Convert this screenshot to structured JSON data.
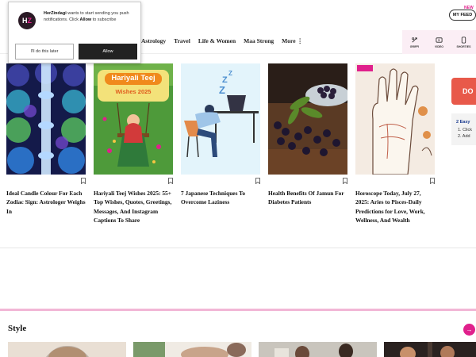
{
  "header": {
    "myfeed_badge": "NEW",
    "myfeed_label": "MY FEED"
  },
  "nav": {
    "items": [
      "Astrology",
      "Travel",
      "Life & Women",
      "Maa Strong",
      "More ⋮"
    ],
    "icons": [
      {
        "name": "griff-icon",
        "label": "GRIFFI"
      },
      {
        "name": "video-icon",
        "label": "VIDEO"
      },
      {
        "name": "shorts-icon",
        "label": "SHORTIES"
      }
    ]
  },
  "popup": {
    "logo_h": "H",
    "logo_z": "Z",
    "site": "HerZindagi",
    "message_1": " wants to start sending you push notifications. Click ",
    "allow_word": "Allow",
    "message_2": " to subscribe",
    "later_label": "I'll do this later",
    "allow_label": "Allow"
  },
  "cards": [
    {
      "category": "",
      "title": "Ideal Candle Colour For Each Zodiac Sign: Astrologer Weighs In",
      "image": "candles"
    },
    {
      "category": "",
      "title": "Hariyali Teej Wishes 2025: 55+ Top Wishes, Quotes, Greetings, Messages, And Instagram Captions To Share",
      "image": "teej",
      "image_text_1": "Hariyali Teej",
      "image_text_2": "Wishes 2025"
    },
    {
      "category": "",
      "title": "7 Japanese Techniques To Overcome Laziness",
      "image": "lazy"
    },
    {
      "category": "",
      "title": "Health Benefits Of Jamun For Diabetes Patients",
      "image": "jamun"
    },
    {
      "category": "",
      "title": "Horoscope Today, July 27, 2025: Aries to Pisces-Daily Predictions for Love, Work, Wellness, And Wealth",
      "image": "palm"
    }
  ],
  "side": {
    "button": "DO",
    "line1": "2 Easy",
    "line2": "1. Click",
    "line3": "2. Add"
  },
  "section": {
    "title": "Style",
    "arrow": "→"
  },
  "colors": {
    "accent": "#e0208c",
    "divider": "#f2b6d6",
    "nav_right_bg": "#fbeef5",
    "side_button": "#e8594a"
  }
}
